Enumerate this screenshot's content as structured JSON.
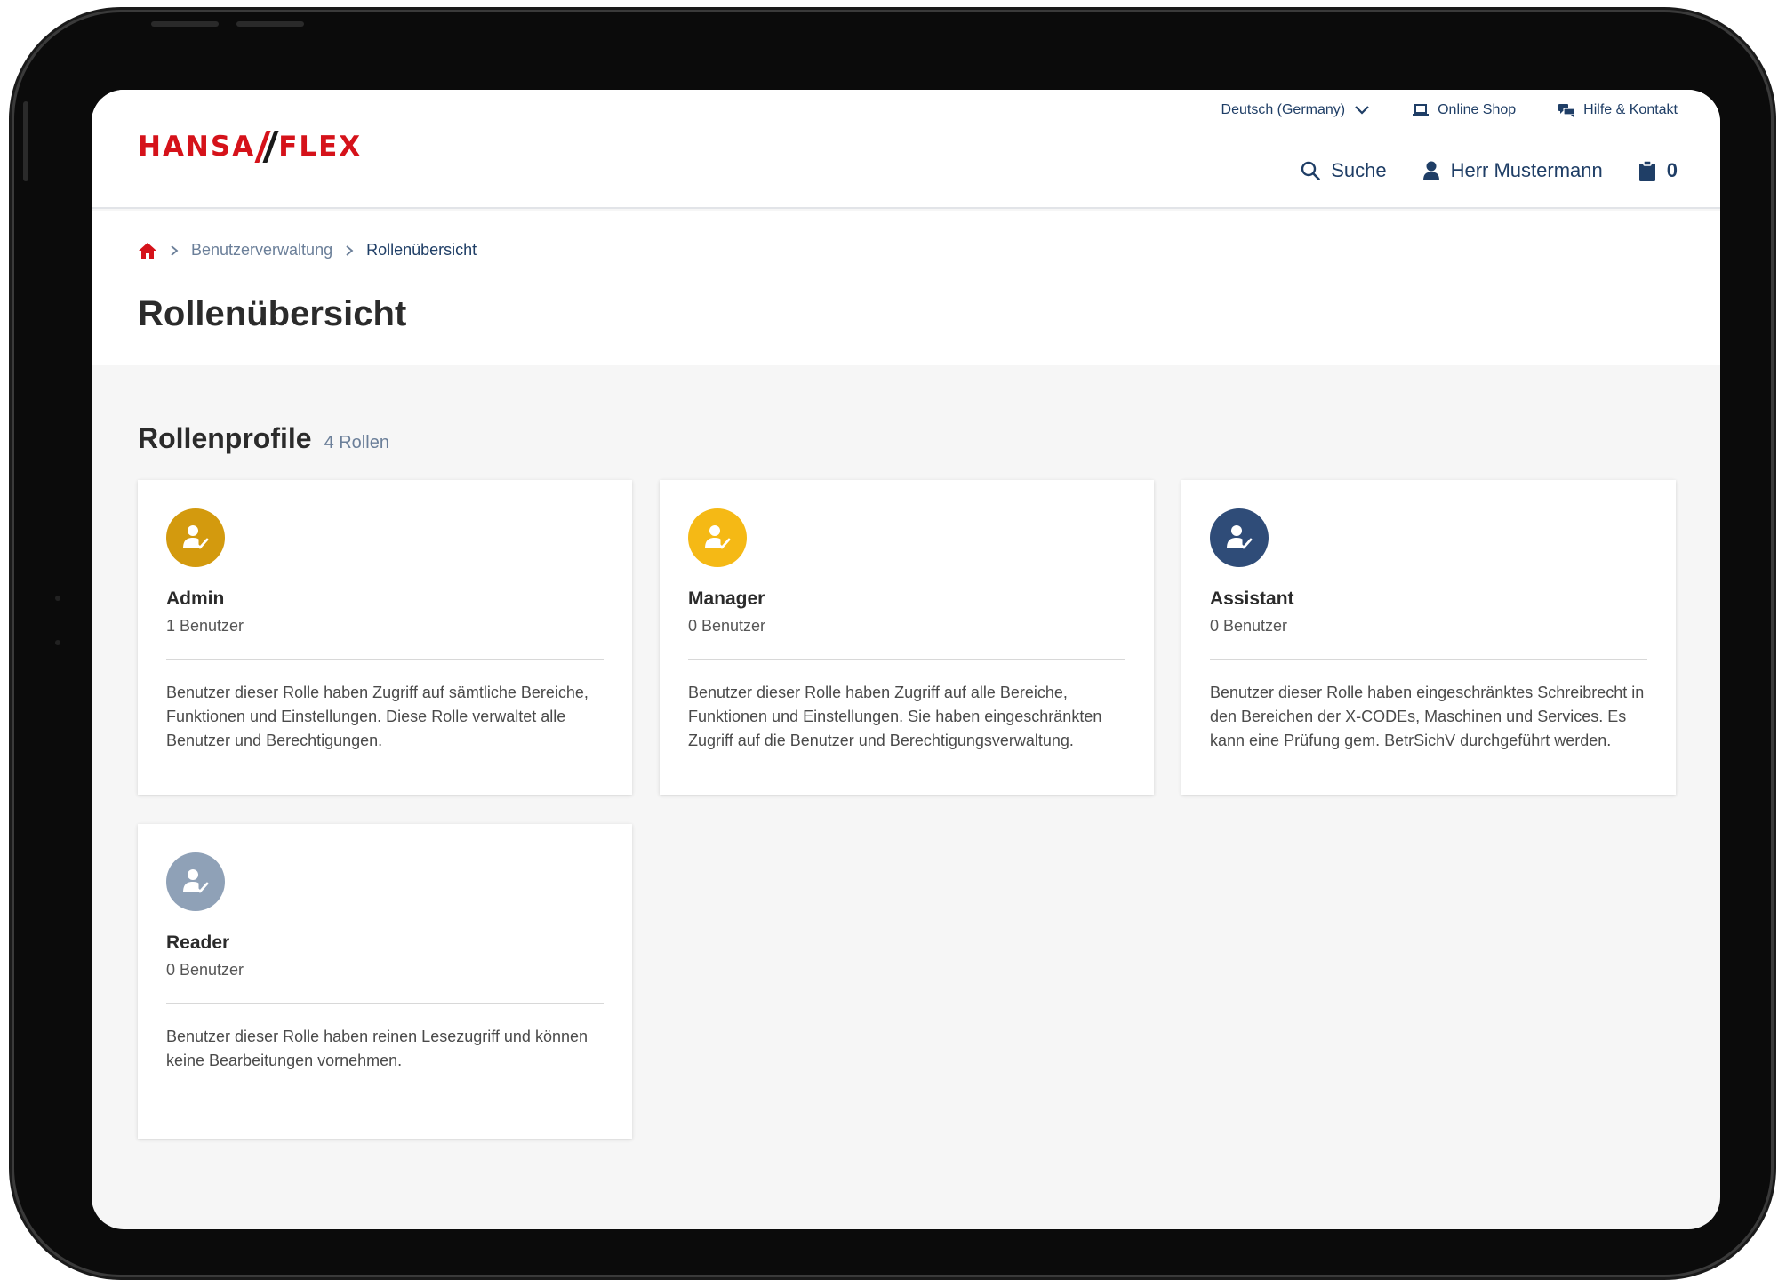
{
  "header": {
    "logo_left": "HANSA",
    "logo_right": "FLEX",
    "language": "Deutsch (Germany)",
    "online_shop": "Online Shop",
    "help_contact": "Hilfe & Kontakt",
    "search": "Suche",
    "user": "Herr Mustermann",
    "cart_count": "0"
  },
  "breadcrumb": {
    "items": [
      "Benutzerverwaltung",
      "Rollenübersicht"
    ]
  },
  "page_title": "Rollenübersicht",
  "section": {
    "title": "Rollenprofile",
    "count": "4 Rollen"
  },
  "roles": [
    {
      "name": "Admin",
      "users": "1 Benutzer",
      "description": "Benutzer dieser Rolle haben Zugriff auf sämtliche Bereiche, Funktionen und Einstellungen. Diese Rolle verwaltet alle Benutzer und Berechtigungen.",
      "color": "#d39a0e"
    },
    {
      "name": "Manager",
      "users": "0 Benutzer",
      "description": "Benutzer dieser Rolle haben Zugriff auf alle Bereiche, Funktionen und Einstellungen. Sie haben eingeschränkten Zugriff auf die Benutzer und Berechtigungsverwaltung.",
      "color": "#f5b915"
    },
    {
      "name": "Assistant",
      "users": "0 Benutzer",
      "description": "Benutzer dieser Rolle haben eingeschränktes Schreibrecht in den Bereichen der X-CODEs, Maschinen und Services. Es kann eine Prüfung gem. BetrSichV durchgeführt werden.",
      "color": "#2f4c78"
    },
    {
      "name": "Reader",
      "users": "0 Benutzer",
      "description": "Benutzer dieser Rolle haben reinen Lesezugriff und können keine Bearbeitungen vornehmen.",
      "color": "#8fa1b7"
    }
  ],
  "colors": {
    "brand_red": "#d5121a",
    "nav_blue": "#1f3e66",
    "muted_blue": "#6b7f99"
  }
}
